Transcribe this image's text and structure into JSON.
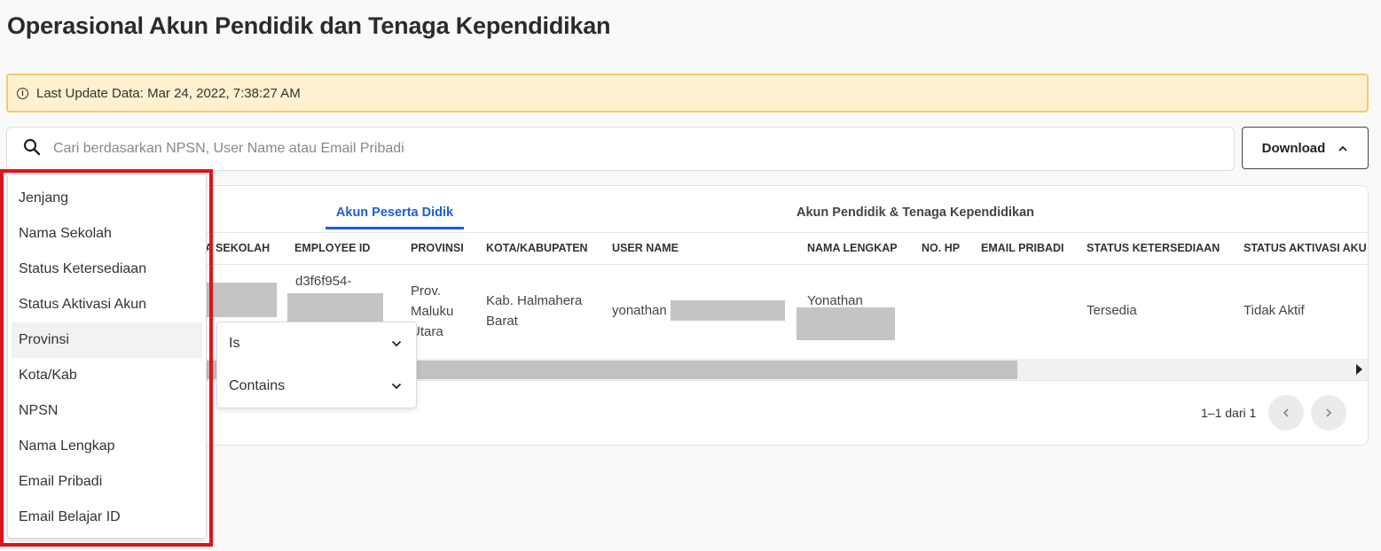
{
  "page": {
    "title": "Operasional Akun Pendidik dan Tenaga Kependidikan"
  },
  "alert": {
    "text": "Last Update Data: Mar 24, 2022, 7:38:27 AM",
    "icon": "info-icon"
  },
  "search": {
    "placeholder": "Cari berdasarkan NPSN, User Name atau Email Pribadi",
    "value": ""
  },
  "download": {
    "label": "Download"
  },
  "tabs": [
    {
      "label": "Akun Peserta Didik",
      "active": true
    },
    {
      "label": "Akun Pendidik & Tenaga Kependidikan",
      "active": false
    }
  ],
  "table": {
    "columns": [
      "A SEKOLAH",
      "EMPLOYEE ID",
      "PROVINSI",
      "KOTA/KABUPATEN",
      "USER NAME",
      "NAMA LENGKAP",
      "NO. HP",
      "EMAIL PRIBADI",
      "STATUS KETERSEDIAAN",
      "STATUS AKTIVASI AKU"
    ],
    "row": {
      "employee_id": "d3f6f954-",
      "provinsi_1": "Prov.",
      "provinsi_2": "Maluku",
      "provinsi_3": "Utara",
      "kota_1": "Kab. Halmahera",
      "kota_2": "Barat",
      "user_name": "yonathan",
      "nama_lengkap": "Yonathan",
      "status_ketersediaan": "Tersedia",
      "status_aktivasi": "Tidak Aktif"
    }
  },
  "pagination": {
    "text": "1–1 dari 1"
  },
  "filter_menu": {
    "items": [
      "Jenjang",
      "Nama Sekolah",
      "Status Ketersediaan",
      "Status Aktivasi Akun",
      "Provinsi",
      "Kota/Kab",
      "NPSN",
      "Nama Lengkap",
      "Email Pribadi",
      "Email Belajar ID"
    ],
    "active_index": 4
  },
  "submenu": {
    "items": [
      "Is",
      "Contains"
    ]
  },
  "colors": {
    "accent": "#1a5fd6",
    "alert_bg": "#fff0cf",
    "alert_border": "#f6c86a",
    "highlight": "#e0121b"
  }
}
